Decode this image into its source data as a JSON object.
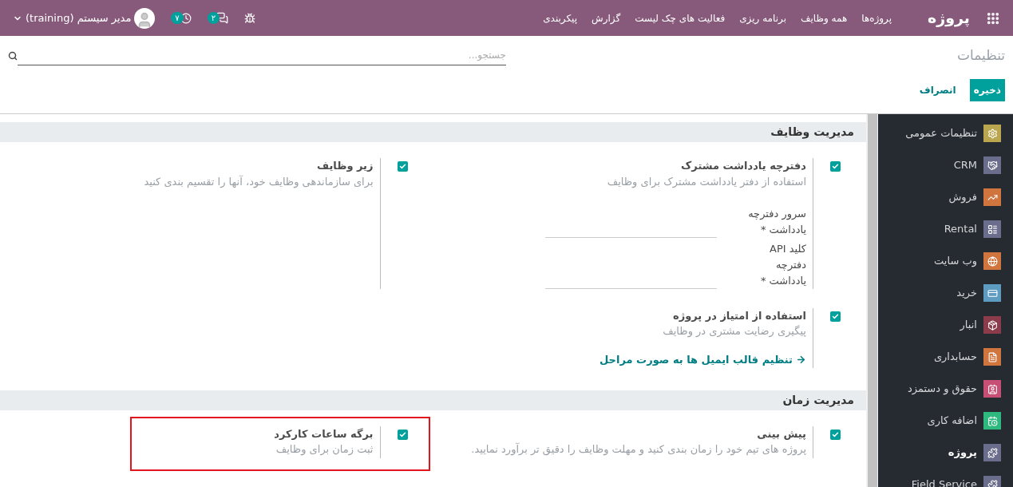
{
  "topbar": {
    "brand": "پروژه",
    "menu": [
      "پروژه‌ها",
      "همه وظایف",
      "برنامه ریزی",
      "فعالیت های چک لیست",
      "گزارش",
      "پیکربندی"
    ],
    "messages_badge": "۲",
    "activities_badge": "۷",
    "user": "مدیر سیستم (training)"
  },
  "control_panel": {
    "title": "تنظیمات",
    "search": {
      "placeholder": "جستجو..."
    },
    "buttons": [
      {
        "label": "ذخیره",
        "kind": "primary"
      },
      {
        "label": "انصراف",
        "kind": "secondary"
      }
    ]
  },
  "sections": [
    {
      "title": "مدیریت وظایف",
      "settings": [
        {
          "title": "دفترچه یادداشت مشترک",
          "description": "استفاده از دفتر یادداشت مشترک برای وظایف",
          "checked": true,
          "highlighted": false,
          "fields": [
            {
              "label": "سرور دفترچه یادداشت *"
            },
            {
              "label": "کلید API دفترچه یادداشت *"
            }
          ]
        },
        {
          "title": "زیر وظایف",
          "description": "برای سازماندهی وظایف خود، آنها را تقسیم بندی کنید",
          "checked": true,
          "highlighted": false
        },
        {
          "title": "استفاده از امتیاز در پروژه",
          "description": "پیگیری رضایت مشتری در وظایف",
          "checked": true,
          "highlighted": false,
          "link": "تنظیم قالب ایمیل ها به صورت مراحل"
        }
      ]
    },
    {
      "title": "مدیریت زمان",
      "settings": [
        {
          "title": "پیش بینی",
          "description": "پروژه های تیم خود را زمان بندی کنید و مهلت وظایف را دقیق تر برآورد نمایید.",
          "checked": true,
          "highlighted": false
        },
        {
          "title": "برگه ساعات کارکرد",
          "description": "ثبت زمان برای وظایف",
          "checked": true,
          "highlighted": true
        }
      ]
    }
  ],
  "sidebar": {
    "items": [
      {
        "label": "تنظیمات عمومی",
        "kind": "settings",
        "color": "#b9a64f",
        "selected": false
      },
      {
        "label": "CRM",
        "kind": "crm",
        "color": "#6b6d8c",
        "selected": false
      },
      {
        "label": "فروش",
        "kind": "sales",
        "color": "#d0753e",
        "selected": false
      },
      {
        "label": "Rental",
        "kind": "rental",
        "color": "#6b6d8c",
        "selected": false
      },
      {
        "label": "وب سایت",
        "kind": "website",
        "color": "#d0753e",
        "selected": false
      },
      {
        "label": "خرید",
        "kind": "purchase",
        "color": "#5e9bc0",
        "selected": false
      },
      {
        "label": "انبار",
        "kind": "inventory",
        "color": "#8c3b4a",
        "selected": false
      },
      {
        "label": "حسابداری",
        "kind": "accounting",
        "color": "#d0753e",
        "selected": false
      },
      {
        "label": "حقوق و دستمزد",
        "kind": "payroll",
        "color": "#c74f75",
        "selected": false
      },
      {
        "label": "اضافه کاری",
        "kind": "overtime",
        "color": "#2eb97e",
        "selected": false
      },
      {
        "label": "پروژه",
        "kind": "project",
        "color": "#6b6d8c",
        "selected": true
      },
      {
        "label": "Field Service",
        "kind": "field",
        "color": "#6b6d8c",
        "selected": false
      }
    ]
  }
}
